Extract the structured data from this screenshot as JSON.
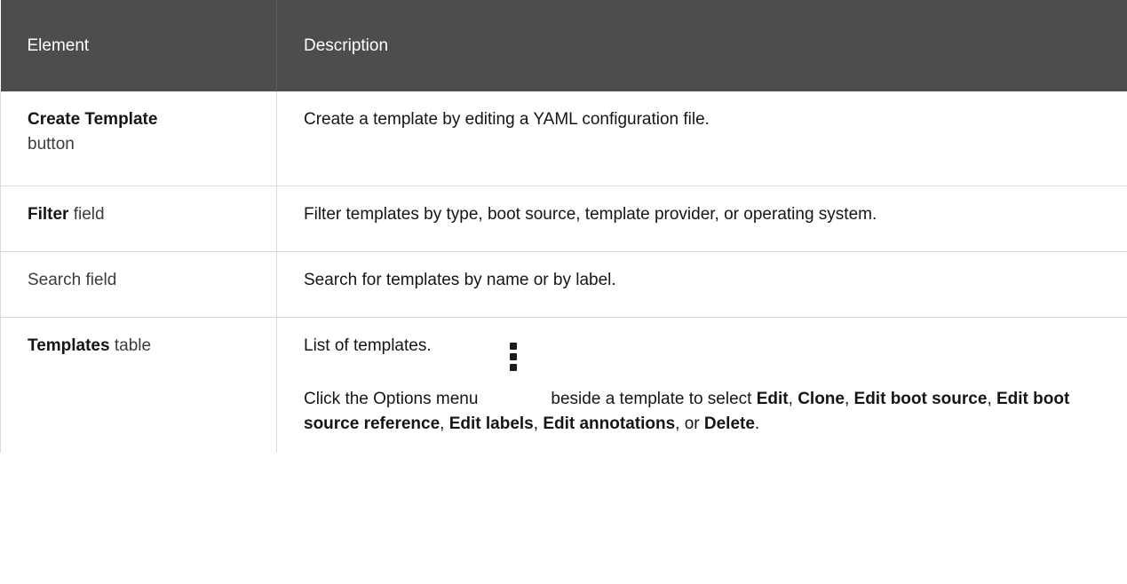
{
  "table": {
    "headers": {
      "element": "Element",
      "description": "Description"
    },
    "rows": [
      {
        "element_bold": "Create Template",
        "element_rest": "button",
        "description": "Create a template by editing a YAML configuration file."
      },
      {
        "element_bold": "Filter",
        "element_rest": " field",
        "description": "Filter templates by type, boot source, template provider, or operating system."
      },
      {
        "element_plain": "Search field",
        "description": "Search for templates by name or by label."
      },
      {
        "element_bold": "Templates",
        "element_rest": " table",
        "description_p1": "List of templates.",
        "description_p2": {
          "prefix": "Click the Options menu",
          "icon": "kebab-vertical-icon",
          "middle": "beside a template to select ",
          "actions": [
            "Edit",
            "Clone",
            "Edit boot source",
            "Edit boot source reference",
            "Edit labels",
            "Edit annotations",
            "Delete"
          ],
          "sep": ", ",
          "or": " or ",
          "end": "."
        }
      }
    ]
  }
}
